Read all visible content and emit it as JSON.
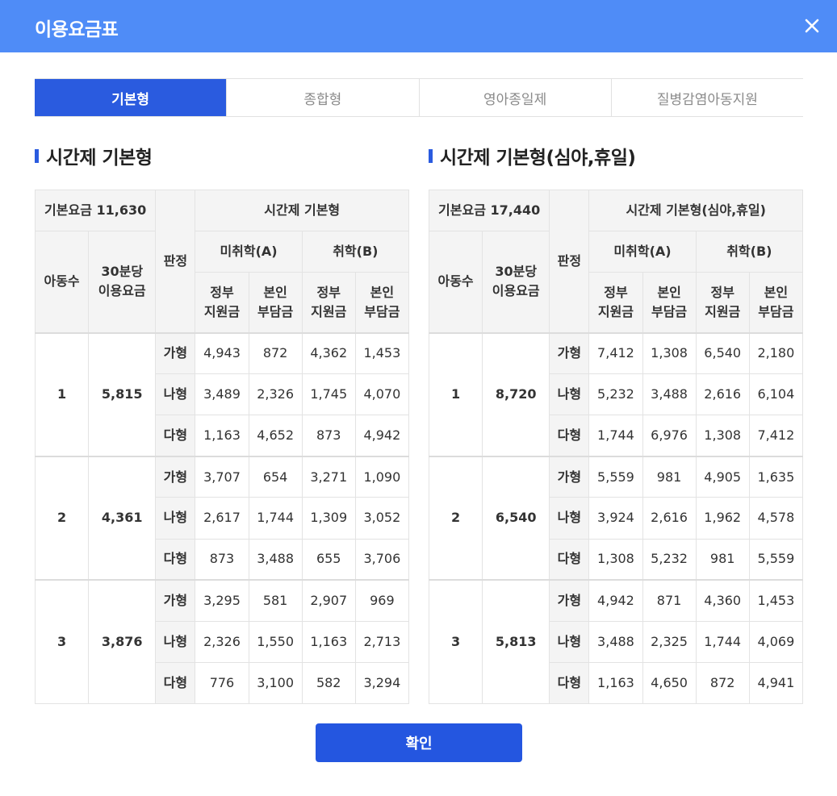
{
  "dialog": {
    "title": "이용요금표",
    "close_icon": "close-icon"
  },
  "tabs": [
    {
      "label": "기본형",
      "active": true
    },
    {
      "label": "종합형",
      "active": false
    },
    {
      "label": "영아종일제",
      "active": false
    },
    {
      "label": "질병감염아동지원",
      "active": false
    }
  ],
  "left": {
    "title": "시간제 기본형",
    "header": {
      "base_fee": "기본요금 11,630",
      "pangjeong": "판정",
      "group_title": "시간제 기본형",
      "child_count": "아동수",
      "per30": "30분당\n이용요금",
      "col_a": "미취학(A)",
      "col_b": "취학(B)",
      "gov": "정부\n지원금",
      "self": "본인\n부담금"
    },
    "groups": [
      {
        "count": "1",
        "fee": "5,815",
        "rows": [
          {
            "type": "가형",
            "a_gov": "4,943",
            "a_self": "872",
            "b_gov": "4,362",
            "b_self": "1,453"
          },
          {
            "type": "나형",
            "a_gov": "3,489",
            "a_self": "2,326",
            "b_gov": "1,745",
            "b_self": "4,070"
          },
          {
            "type": "다형",
            "a_gov": "1,163",
            "a_self": "4,652",
            "b_gov": "873",
            "b_self": "4,942"
          }
        ]
      },
      {
        "count": "2",
        "fee": "4,361",
        "rows": [
          {
            "type": "가형",
            "a_gov": "3,707",
            "a_self": "654",
            "b_gov": "3,271",
            "b_self": "1,090"
          },
          {
            "type": "나형",
            "a_gov": "2,617",
            "a_self": "1,744",
            "b_gov": "1,309",
            "b_self": "3,052"
          },
          {
            "type": "다형",
            "a_gov": "873",
            "a_self": "3,488",
            "b_gov": "655",
            "b_self": "3,706"
          }
        ]
      },
      {
        "count": "3",
        "fee": "3,876",
        "rows": [
          {
            "type": "가형",
            "a_gov": "3,295",
            "a_self": "581",
            "b_gov": "2,907",
            "b_self": "969"
          },
          {
            "type": "나형",
            "a_gov": "2,326",
            "a_self": "1,550",
            "b_gov": "1,163",
            "b_self": "2,713"
          },
          {
            "type": "다형",
            "a_gov": "776",
            "a_self": "3,100",
            "b_gov": "582",
            "b_self": "3,294"
          }
        ]
      }
    ]
  },
  "right": {
    "title": "시간제 기본형(심야,휴일)",
    "header": {
      "base_fee": "기본요금 17,440",
      "pangjeong": "판정",
      "group_title": "시간제 기본형(심야,휴일)",
      "child_count": "아동수",
      "per30": "30분당\n이용요금",
      "col_a": "미취학(A)",
      "col_b": "취학(B)",
      "gov": "정부\n지원금",
      "self": "본인\n부담금"
    },
    "groups": [
      {
        "count": "1",
        "fee": "8,720",
        "rows": [
          {
            "type": "가형",
            "a_gov": "7,412",
            "a_self": "1,308",
            "b_gov": "6,540",
            "b_self": "2,180"
          },
          {
            "type": "나형",
            "a_gov": "5,232",
            "a_self": "3,488",
            "b_gov": "2,616",
            "b_self": "6,104"
          },
          {
            "type": "다형",
            "a_gov": "1,744",
            "a_self": "6,976",
            "b_gov": "1,308",
            "b_self": "7,412"
          }
        ]
      },
      {
        "count": "2",
        "fee": "6,540",
        "rows": [
          {
            "type": "가형",
            "a_gov": "5,559",
            "a_self": "981",
            "b_gov": "4,905",
            "b_self": "1,635"
          },
          {
            "type": "나형",
            "a_gov": "3,924",
            "a_self": "2,616",
            "b_gov": "1,962",
            "b_self": "4,578"
          },
          {
            "type": "다형",
            "a_gov": "1,308",
            "a_self": "5,232",
            "b_gov": "981",
            "b_self": "5,559"
          }
        ]
      },
      {
        "count": "3",
        "fee": "5,813",
        "rows": [
          {
            "type": "가형",
            "a_gov": "4,942",
            "a_self": "871",
            "b_gov": "4,360",
            "b_self": "1,453"
          },
          {
            "type": "나형",
            "a_gov": "3,488",
            "a_self": "2,325",
            "b_gov": "1,744",
            "b_self": "4,069"
          },
          {
            "type": "다형",
            "a_gov": "1,163",
            "a_self": "4,650",
            "b_gov": "872",
            "b_self": "4,941"
          }
        ]
      }
    ]
  },
  "confirm_label": "확인",
  "colors": {
    "header_bg": "#4f8cf7",
    "active_tab": "#2a5bdf",
    "button": "#2456e0"
  }
}
